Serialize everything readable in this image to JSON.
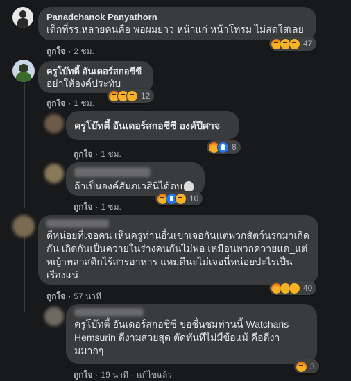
{
  "comments": [
    {
      "author": "Panadchanok Panyathorn",
      "text": "เด็กที่รร.หลายคนคือ พอผมยาว หน้าแก่ หน้าโทรม ไม่สดใสเลย",
      "like_label": "ถูกใจ",
      "time": "2 ชม.",
      "reaction_count": "47",
      "reactions": [
        "angry-icon",
        "haha-icon",
        "wow-icon"
      ]
    },
    {
      "author": "ครูโบ๊ทตี้ อันเดอร์สกอซีซี",
      "text": "อย่าให้องค์ประทับ",
      "like_label": "ถูกใจ",
      "time": "1 ชม.",
      "reaction_count": "12",
      "reactions": [
        "angry-icon",
        "haha-icon",
        "wow-icon"
      ]
    },
    {
      "author": "ครูโบ๊ทตี้ อันเดอร์สกอซีซี องค์ปีศาจ",
      "like_label": "ถูกใจ",
      "time": "1 ชม.",
      "reaction_count": "8",
      "reactions": [
        "angry-icon",
        "like-icon"
      ]
    },
    {
      "text": "ถ้าเป็นองค์สัมภเวสีนี่ได้ดบ",
      "like_label": "ถูกใจ",
      "time": "1 ชม.",
      "reaction_count": "10",
      "reactions": [
        "angry-icon",
        "like-icon",
        "wow-icon"
      ]
    },
    {
      "text": "ดีหน่อยที่เจอคน เห็นครูท่านอื่นเขาเจอกันแต่พวกสัตว์นรกมาเกิดกัน เกิดกันเป็นควายในร่างคนกันไม่พอ เหมือนพวกควายแด_แต่หญ้าพลาสติกไร้สารอาหาร แหมดีนะไม่เจอนี่หน่อยปะไรเป็นเรื่องแน่",
      "like_label": "ถูกใจ",
      "time": "57 นาที",
      "reaction_count": "40",
      "reactions": [
        "angry-icon",
        "haha-icon",
        "wow-icon"
      ]
    },
    {
      "text": "ครูโบ๊ทตี้ อันเดอร์สกอซีซี ขอชื่นชมท่านนี้ Watcharis Hemsurin ดีงามสวยสุด ตัดทันทีไม่มีข้อแม้ คือดีงามมากๆ",
      "like_label": "ถูกใจ",
      "time": "19 นาที",
      "edited": "แก้ไขแล้ว",
      "reaction_count": "3",
      "reactions": [
        "angry-icon"
      ]
    }
  ],
  "colors": {
    "background": "#18191a",
    "bubble": "#3a3b3c",
    "text": "#e4e6eb",
    "meta": "#b0b3b8"
  }
}
